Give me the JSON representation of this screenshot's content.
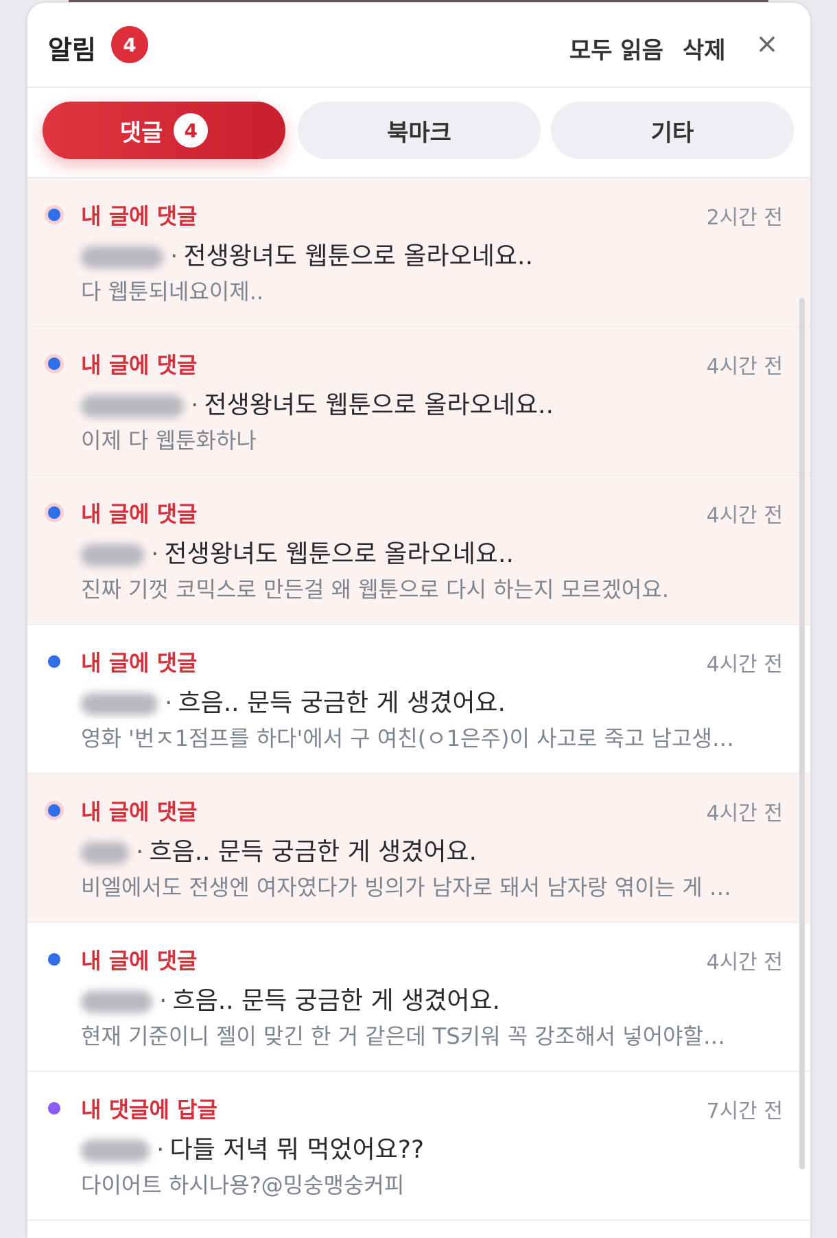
{
  "header": {
    "title": "알림",
    "count": "4",
    "mark_all_read": "모두 읽음",
    "delete": "삭제",
    "close_symbol": "×"
  },
  "tabs": [
    {
      "label": "댓글",
      "badge": "4",
      "active": true
    },
    {
      "label": "북마크"
    },
    {
      "label": "기타"
    }
  ],
  "notifications": [
    {
      "type": "내 글에 댓글",
      "time": "2시간 전",
      "title": "전생왕녀도 웹툰으로 올라오네요..",
      "preview": "다 웹툰되네요이제..",
      "unread": true
    },
    {
      "type": "내 글에 댓글",
      "time": "4시간 전",
      "title": "전생왕녀도 웹툰으로 올라오네요..",
      "preview": "이제 다 웹툰화하나",
      "unread": true
    },
    {
      "type": "내 글에 댓글",
      "time": "4시간 전",
      "title": "전생왕녀도 웹툰으로 올라오네요..",
      "preview": "진짜 기껏 코믹스로 만든걸 왜 웹툰으로 다시 하는지 모르겠어요.",
      "unread": true
    },
    {
      "type": "내 글에 댓글",
      "time": "4시간 전",
      "title": "흐음.. 문득 궁금한 게 생겼어요.",
      "preview": "영화 '번ㅈ1점프를 하다'에서 구 여친(ㅇ1은주)이 사고로 죽고 남고생…",
      "unread": false
    },
    {
      "type": "내 글에 댓글",
      "time": "4시간 전",
      "title": "흐음.. 문득 궁금한 게 생겼어요.",
      "preview": "비엘에서도 전생엔 여자였다가 빙의가 남자로 돼서 남자랑 엮이는 게 …",
      "unread": true
    },
    {
      "type": "내 글에 댓글",
      "time": "4시간 전",
      "title": "흐음.. 문득 궁금한 게 생겼어요.",
      "preview": "현재 기준이니 젤이 맞긴 한 거 같은데 TS키워 꼭 강조해서 넣어야할…",
      "unread": false
    },
    {
      "type": "내 댓글에 답글",
      "time": "7시간 전",
      "title": "다들 저녁 뭐 먹었어요??",
      "preview": "다이어트 하시나용?@밍숭맹숭커피",
      "unread": false
    }
  ],
  "colors": {
    "accent": "#dc2f3b",
    "unread_bg": "#fcf2f2",
    "dot_blue": "#2f6fe8",
    "dot_purple": "#8b5cf6"
  },
  "icons": {
    "close": "close-icon",
    "unread_dot": "unread-dot-icon"
  }
}
